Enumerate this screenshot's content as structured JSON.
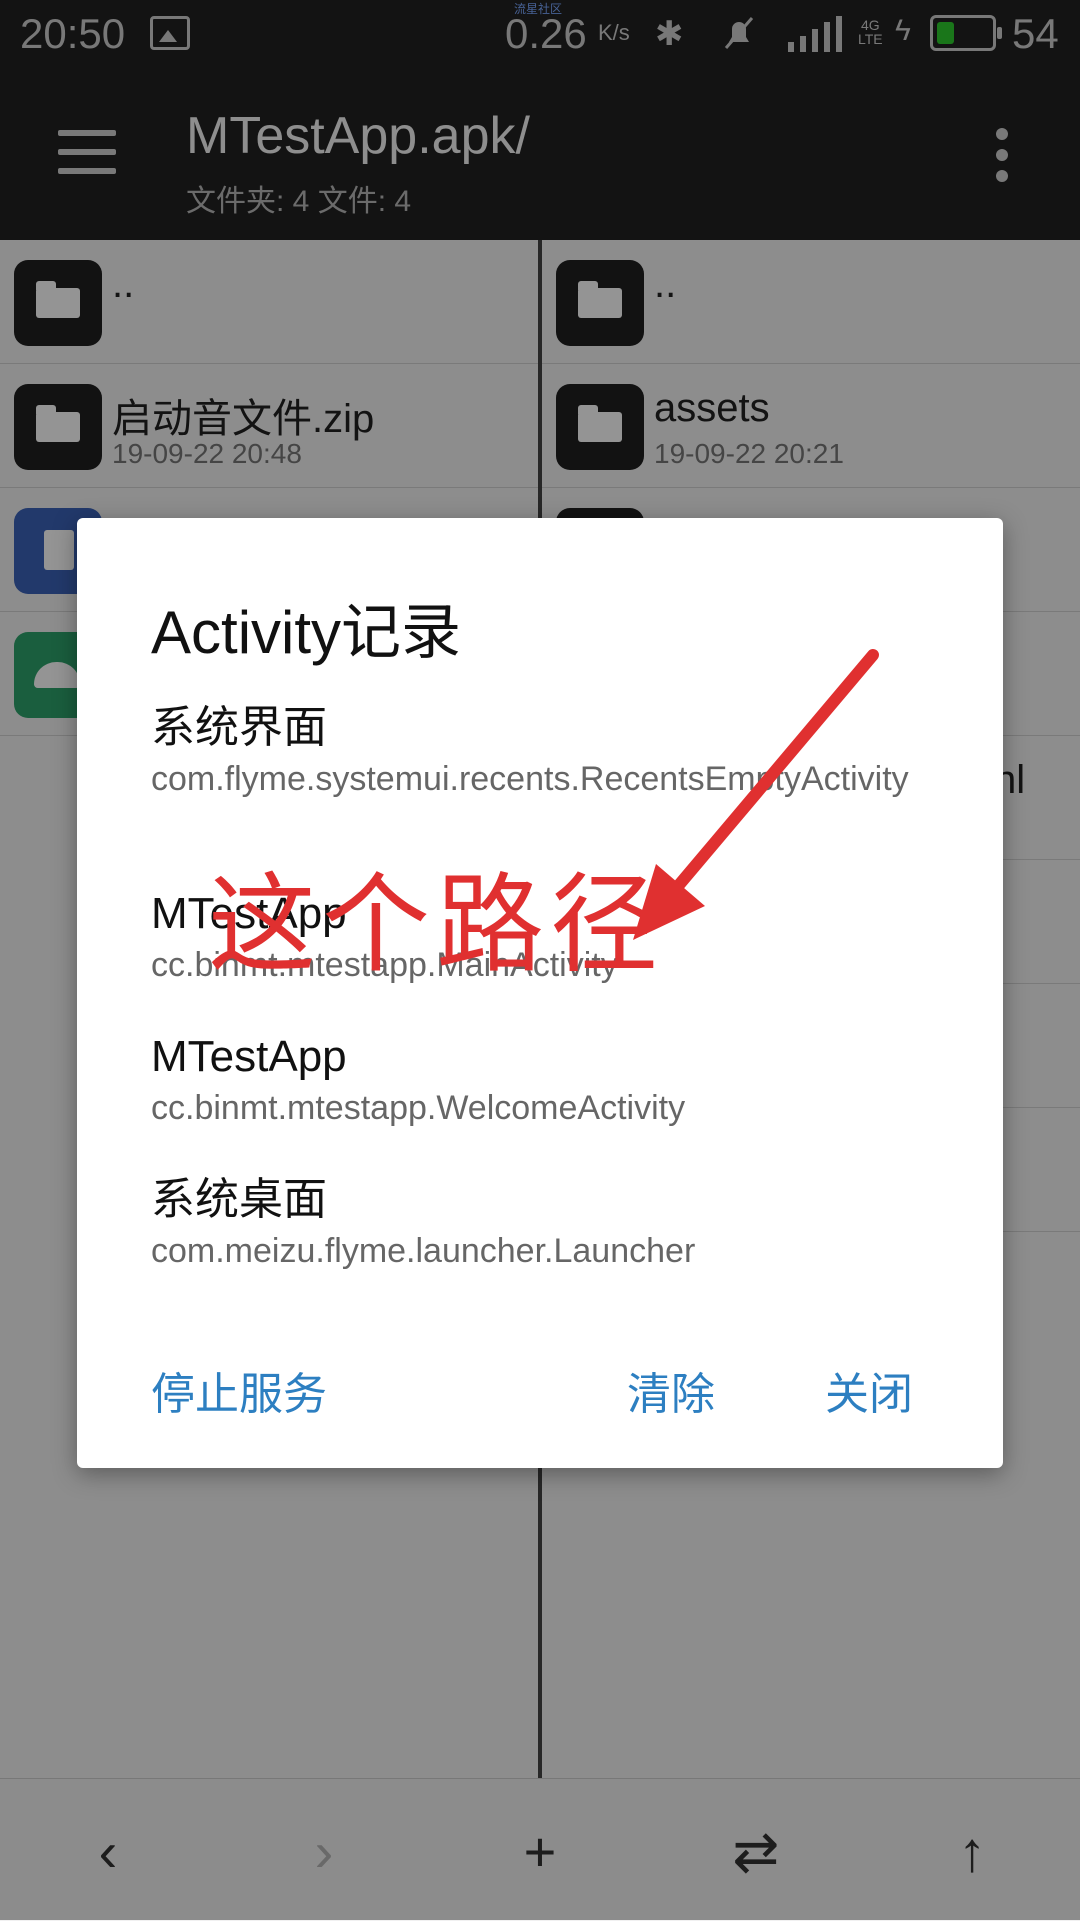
{
  "status_bar": {
    "time": "20:50",
    "watermark": "流星社区",
    "net_speed": "0.26",
    "net_unit": "K/s",
    "network_type_top": "4G",
    "network_type_bottom": "LTE",
    "battery_level": "54",
    "battery_color": "#2ecc2e"
  },
  "toolbar": {
    "title": "MTestApp.apk/",
    "subtitle": "文件夹: 4  文件: 4"
  },
  "left_pane": {
    "rows": [
      {
        "name": "..",
        "date": ""
      },
      {
        "name": "启动音文件.zip",
        "date": "19-09-22 20:48"
      }
    ]
  },
  "right_pane": {
    "rows": [
      {
        "name": "..",
        "date": ""
      },
      {
        "name": "assets",
        "date": "19-09-22 20:21"
      }
    ],
    "partial_suffix": "nl"
  },
  "dialog": {
    "title": "Activity记录",
    "entries": [
      {
        "name": "系统界面",
        "activity": "com.flyme.systemui.recents.RecentsEmptyActivity"
      },
      {
        "name": "MTestApp",
        "activity": "cc.binmt.mtestapp.MainActivity"
      },
      {
        "name": "MTestApp",
        "activity": "cc.binmt.mtestapp.WelcomeActivity"
      },
      {
        "name": "系统桌面",
        "activity": "com.meizu.flyme.launcher.Launcher"
      }
    ],
    "buttons": {
      "stop_service": "停止服务",
      "clear": "清除",
      "close": "关闭"
    },
    "accent_color": "#2d7fc1"
  },
  "annotation": {
    "text": "这个路径",
    "color": "#e03030"
  },
  "bottom_bar": {
    "back": "‹",
    "forward": "›",
    "add": "+",
    "swap": "⇄",
    "up": "↑"
  }
}
